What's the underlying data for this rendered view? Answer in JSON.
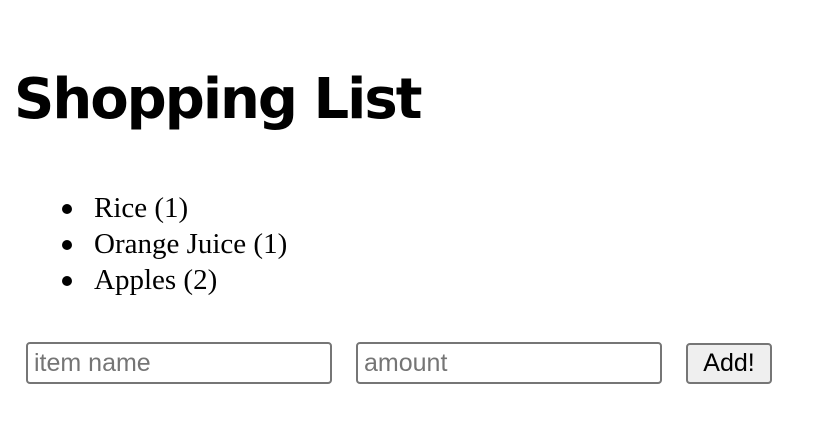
{
  "page": {
    "title": "Shopping List"
  },
  "items": [
    {
      "label": "Rice (1)"
    },
    {
      "label": "Orange Juice (1)"
    },
    {
      "label": "Apples (2)"
    }
  ],
  "form": {
    "item_name_value": "",
    "item_name_placeholder": "item name",
    "amount_value": "",
    "amount_placeholder": "amount",
    "add_label": "Add!"
  }
}
